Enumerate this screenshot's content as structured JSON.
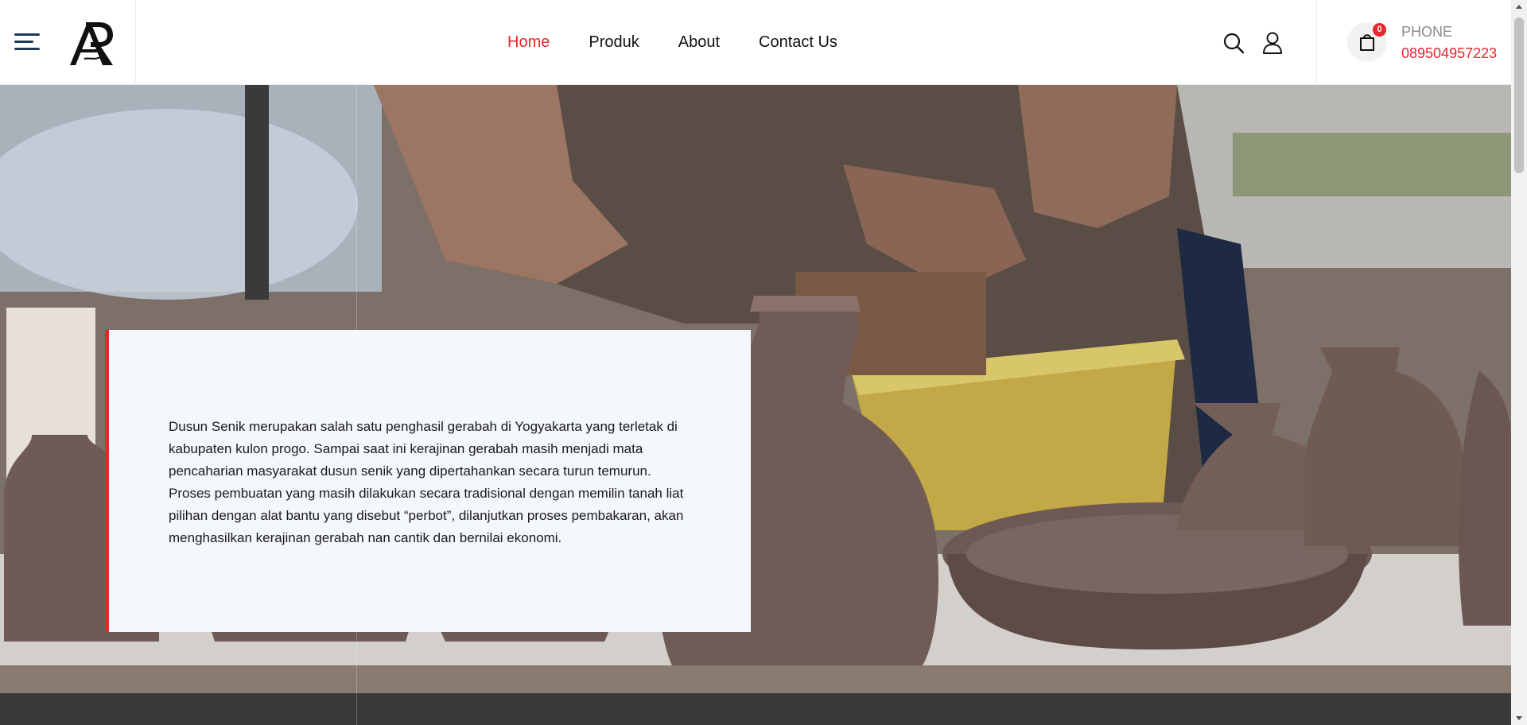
{
  "header": {
    "menu_icon": "hamburger-menu-icon",
    "logo_icon": "ar-logo-icon",
    "nav": [
      {
        "label": "Home",
        "active": true
      },
      {
        "label": "Produk",
        "active": false
      },
      {
        "label": "About",
        "active": false
      },
      {
        "label": "Contact Us",
        "active": false
      }
    ],
    "search_icon": "search-icon",
    "user_icon": "user-icon",
    "cart": {
      "icon": "shopping-bag-icon",
      "count": "0"
    },
    "phone": {
      "label": "PHONE",
      "number": "089504957223"
    }
  },
  "hero": {
    "background": "pottery-making-photo",
    "text": "Dusun Senik merupakan salah satu penghasil gerabah di Yogyakarta yang terletak di kabupaten kulon progo. Sampai saat ini kerajinan gerabah masih menjadi mata pencaharian masyarakat dusun senik yang dipertahankan secara turun temurun. Proses pembuatan yang masih dilakukan secara tradisional dengan memilin tanah liat pilihan dengan alat bantu yang disebut “perbot”, dilanjutkan proses pembakaran, akan menghasilkan kerajinan gerabah nan cantik dan bernilai ekonomi."
  },
  "colors": {
    "accent": "#e8262d",
    "text": "#111111",
    "card_bg": "#f4f7fb",
    "menu_icon": "#1a3a5c"
  }
}
